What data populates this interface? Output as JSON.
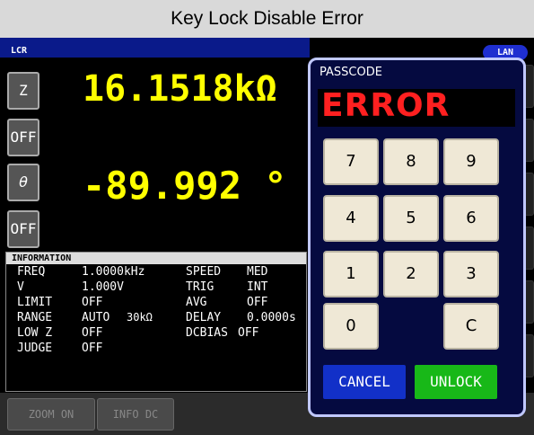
{
  "window": {
    "title": "Key Lock Disable Error"
  },
  "header": {
    "mode": "LCR",
    "lan": "LAN"
  },
  "params": [
    {
      "label": "Z",
      "off_label": "OFF"
    },
    {
      "label": "θ",
      "off_label": "OFF"
    }
  ],
  "measurements": {
    "z_value": "16.1518kΩ",
    "theta_value": "-89.992 °"
  },
  "info": {
    "header": "INFORMATION",
    "rows": [
      {
        "k1": "FREQ",
        "v1": "1.0000kHz",
        "k2": "SPEED",
        "v2": "MED"
      },
      {
        "k1": "V",
        "v1": "1.000V",
        "k2": "TRIG",
        "v2": "INT"
      },
      {
        "k1": "LIMIT",
        "v1": "OFF",
        "k2": "AVG",
        "v2": "OFF"
      },
      {
        "k1": "RANGE",
        "v1": "AUTO",
        "v1b": "30kΩ",
        "k2": "DELAY",
        "v2": "0.0000s"
      },
      {
        "k1": "LOW Z",
        "v1": "OFF",
        "k2": "DCBIAS",
        "v2": "OFF"
      },
      {
        "k1": "JUDGE",
        "v1": "OFF"
      }
    ]
  },
  "bottom": {
    "zoom": "ZOOM ON",
    "info_dc": "INFO DC"
  },
  "dialog": {
    "label": "PASSCODE",
    "error": "ERROR",
    "keys": [
      "7",
      "8",
      "9",
      "4",
      "5",
      "6",
      "1",
      "2",
      "3",
      "0",
      "C"
    ],
    "cancel": "CANCEL",
    "unlock": "UNLOCK"
  },
  "colors": {
    "measurement": "#ffff00",
    "error": "#ff2020",
    "cancel_bg": "#1230c8",
    "unlock_bg": "#18b818",
    "panel_border": "#c0c8ff"
  }
}
